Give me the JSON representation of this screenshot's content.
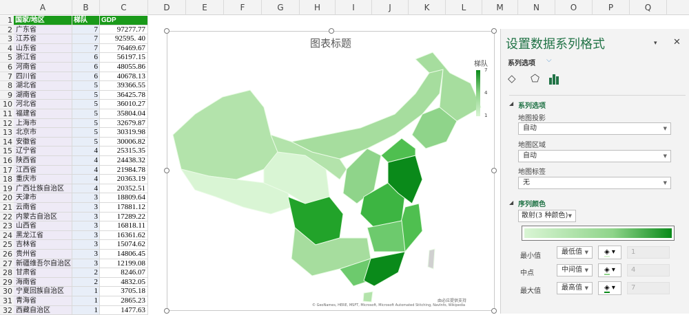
{
  "columns": [
    "A",
    "B",
    "C",
    "D",
    "E",
    "F",
    "G",
    "H",
    "I",
    "J",
    "K",
    "L",
    "M",
    "N",
    "O",
    "P",
    "Q"
  ],
  "table": {
    "headers": [
      "国家/地区",
      "梯队",
      "GDP"
    ],
    "rows": [
      [
        "广东省",
        "7",
        "97277.77"
      ],
      [
        "江苏省",
        "7",
        "92595. 40"
      ],
      [
        "山东省",
        "7",
        "76469.67"
      ],
      [
        "浙江省",
        "6",
        "56197.15"
      ],
      [
        "河南省",
        "6",
        "48055.86"
      ],
      [
        "四川省",
        "6",
        "40678.13"
      ],
      [
        "湖北省",
        "5",
        "39366.55"
      ],
      [
        "湖南省",
        "5",
        "36425.78"
      ],
      [
        "河北省",
        "5",
        "36010.27"
      ],
      [
        "福建省",
        "5",
        "35804.04"
      ],
      [
        "上海市",
        "5",
        "32679.87"
      ],
      [
        "北京市",
        "5",
        "30319.98"
      ],
      [
        "安徽省",
        "5",
        "30006.82"
      ],
      [
        "辽宁省",
        "4",
        "25315.35"
      ],
      [
        "陕西省",
        "4",
        "24438.32"
      ],
      [
        "江西省",
        "4",
        "21984.78"
      ],
      [
        "重庆市",
        "4",
        "20363.19"
      ],
      [
        "广西壮族自治区",
        "4",
        "20352.51"
      ],
      [
        "天津市",
        "3",
        "18809.64"
      ],
      [
        "云南省",
        "3",
        "17881.12"
      ],
      [
        "内蒙古自治区",
        "3",
        "17289.22"
      ],
      [
        "山西省",
        "3",
        "16818.11"
      ],
      [
        "黑龙江省",
        "3",
        "16361.62"
      ],
      [
        "吉林省",
        "3",
        "15074.62"
      ],
      [
        "贵州省",
        "3",
        "14806.45"
      ],
      [
        "新疆维吾尔自治区",
        "3",
        "12199.08"
      ],
      [
        "甘肃省",
        "2",
        "8246.07"
      ],
      [
        "海南省",
        "2",
        "4832.05"
      ],
      [
        "宁夏回族自治区",
        "1",
        "3705.18"
      ],
      [
        "青海省",
        "1",
        "2865.23"
      ],
      [
        "西藏自治区",
        "1",
        "1477.63"
      ]
    ]
  },
  "chart": {
    "title": "图表标题",
    "legend_title": "梯队",
    "legend_ticks": [
      "7",
      "4",
      "1"
    ],
    "attribution": "© GeoNames, HERE, MSFT, Microsoft, Microsoft Automated Stitching, NavInfo, Wikipedia",
    "powered_by": "由必应提供支持",
    "colors": {
      "min": "#d9f5d4",
      "mid": "#8fd48a",
      "max": "#0a8a1a"
    }
  },
  "panel": {
    "title": "设置数据系列格式",
    "options_dropdown": "系列选项",
    "section1": "系列选项",
    "projection_label": "地图投影",
    "projection_value": "自动",
    "area_label": "地图区域",
    "area_value": "自动",
    "labels_label": "地图标签",
    "labels_value": "无",
    "section2": "序列颜色",
    "color_scheme": "散射(3 种颜色)",
    "min_label": "最小值",
    "min_type": "最低值",
    "min_value": "1",
    "mid_label": "中点",
    "mid_type": "中间值",
    "mid_value": "4",
    "max_label": "最大值",
    "max_type": "最高值",
    "max_value": "7"
  }
}
